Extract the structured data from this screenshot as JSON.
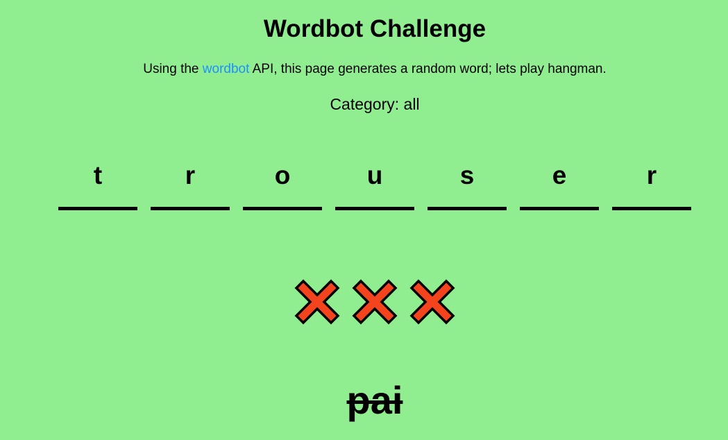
{
  "page": {
    "title": "Wordbot Challenge",
    "intro_before": "Using the ",
    "intro_link": "wordbot",
    "intro_after": " API, this page generates a random word; lets play hangman.",
    "category_label": "Category: ",
    "category_value": "all"
  },
  "word": {
    "letters": [
      "t",
      "r",
      "o",
      "u",
      "s",
      "e",
      "r"
    ]
  },
  "strikes": {
    "count": 3,
    "icon": "x-mark-icon",
    "fill_color": "#f4441e",
    "stroke_color": "#000000"
  },
  "guess": {
    "text": "pai",
    "struck_through": true
  },
  "colors": {
    "background": "#90ee90",
    "link": "#1e90ff"
  }
}
